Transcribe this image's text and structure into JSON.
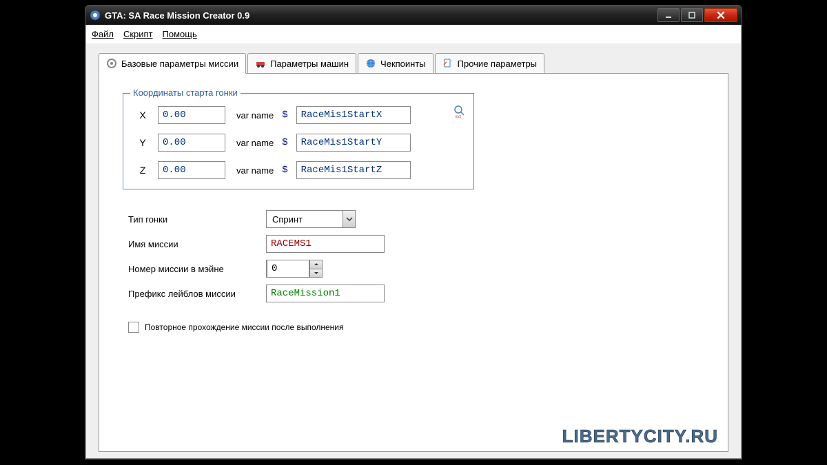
{
  "window": {
    "title": "GTA: SA Race Mission Creator 0.9"
  },
  "menubar": {
    "file": "Файл",
    "script": "Скрипт",
    "help": "Помощь"
  },
  "tabs": {
    "basic": "Базовые параметры миссии",
    "vehicles": "Параметры машин",
    "checkpoints": "Чекпоинты",
    "other": "Прочие параметры"
  },
  "fieldset": {
    "legend": "Координаты старта гонки",
    "rows": [
      {
        "axis": "X",
        "value": "0.00",
        "var_label": "var name",
        "var_name": "RaceMis1StartX"
      },
      {
        "axis": "Y",
        "value": "0.00",
        "var_label": "var name",
        "var_name": "RaceMis1StartY"
      },
      {
        "axis": "Z",
        "value": "0.00",
        "var_label": "var name",
        "var_name": "RaceMis1StartZ"
      }
    ]
  },
  "form": {
    "race_type_label": "Тип гонки",
    "race_type_value": "Спринт",
    "mission_name_label": "Имя миссии",
    "mission_name_value": "RACEMS1",
    "mission_number_label": "Номер миссии в мэйне",
    "mission_number_value": "0",
    "label_prefix_label": "Префикс лейблов миссии",
    "label_prefix_value": "RaceMission1",
    "repeat_checkbox_label": "Повторное прохождение миссии после выполнения"
  },
  "watermark": "LIBERTYCITY.RU"
}
